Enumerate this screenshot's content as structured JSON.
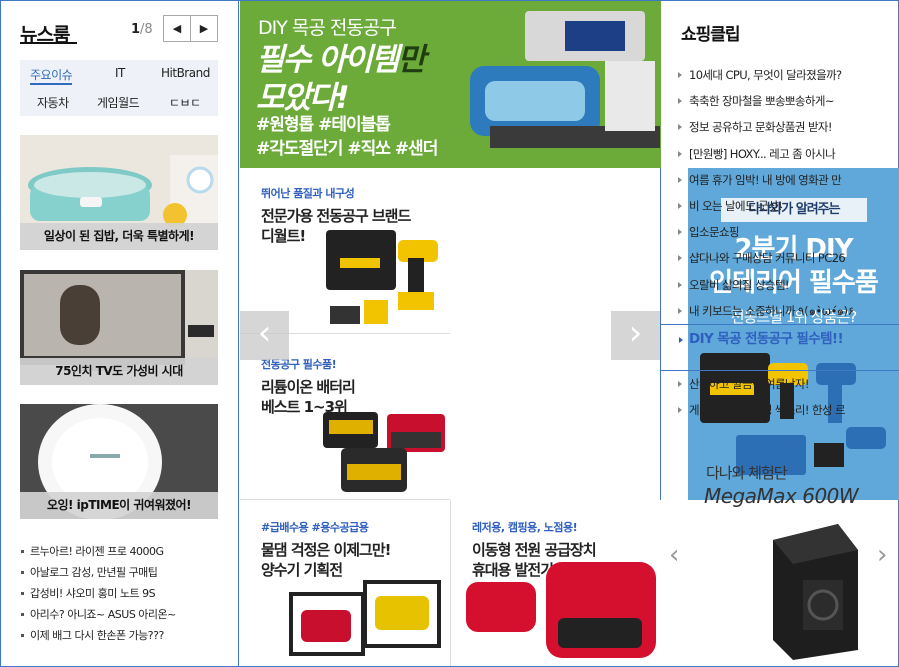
{
  "news": {
    "title": "뉴스룸",
    "page_current": "1",
    "page_total": "/8",
    "prev_label": "◀",
    "next_label": "▶",
    "categories": [
      "주요이슈",
      "IT",
      "HitBrand",
      "자동차",
      "게임월드",
      "ㄷㅂㄷ"
    ],
    "thumbs": [
      {
        "caption": "일상이 된 집밥, 더욱 특별하게!"
      },
      {
        "caption": "75인치 TV도 가성비 시대"
      },
      {
        "caption": "오잉! ipTIME이 귀여워졌어!"
      }
    ],
    "list": [
      "르누아르! 라이젠 프로 4000G",
      "아날로그 감성, 만년필 구매팁",
      "갑성비! 샤오미 홍미 노트 9S",
      "아리수? 아니죠~ ASUS 아리온~",
      "이제 배그 다시 한손폰 가능???"
    ]
  },
  "center": {
    "banner": {
      "sub": "DIY 목공 전동공구",
      "head_a": "필수 아이템",
      "head_hl": "만",
      "head_b": "모았다!",
      "tags_1": "#원형톱 #테이블톱",
      "tags_2": "#각도절단기 #직쏘 #샌더"
    },
    "cells": [
      {
        "kicker": "뛰어난 품질과 내구성",
        "title_1": "전문가용 전동공구 브랜드",
        "title_2": "디월트!"
      },
      {
        "kicker": "전동공구 필수품!",
        "title_1": "리튬이온 배터리",
        "title_2": "베스트 1~3위"
      },
      {
        "kicker": "#급배수용 #용수공급용",
        "title_1": "물댐 걱정은 이제그만!",
        "title_2": "양수기 기획전"
      },
      {
        "kicker": "레저용, 캠핑용, 노점용!",
        "title_1": "이동형 전원 공급장치",
        "title_2": "휴대용 발전기"
      }
    ],
    "feature": {
      "badge": "다나와가 알려주는",
      "big_1": "2분기 DIY",
      "big_2": "인테리어 필수품",
      "desc": "전동드릴 1위 상품은?"
    },
    "arrow_prev": "‹",
    "arrow_next": "›"
  },
  "shop": {
    "title": "쇼핑클립",
    "items": [
      "10세대 CPU, 무엇이 달라졌을까?",
      "축축한 장마철을 뽀송뽀송하게~",
      "정보 공유하고 문화상품권 받자!",
      "[만원빵] HOXY... 레고 좀 아시나",
      "여름 휴가 임박! 내 방에 영화관 만",
      "비 오는 날에도 굿샷!",
      "입소문쇼핑",
      "샵다나와 구매상담 커뮤니티 PC26",
      "오랄비 삶의질 상승템!",
      "내 키보드는 소중하니까 ٩(๑•̀ω•́๑)۶",
      "DIY 목공 전동공구 필수템!!",
      "산뜻하고 깔끔한 여름남자!",
      "게이밍노트북 랭킹 싹쓰리! 한성 르"
    ],
    "active_index": 10,
    "ad": {
      "line1": "다나와 체험단",
      "line2": "MegaMax 600W",
      "prev": "‹",
      "next": "›"
    }
  },
  "colors": {
    "accent": "#3f78c4",
    "banner_green": "#6cab3a",
    "feature_blue": "#5fa8d9",
    "link_blue": "#2f5fbf"
  }
}
